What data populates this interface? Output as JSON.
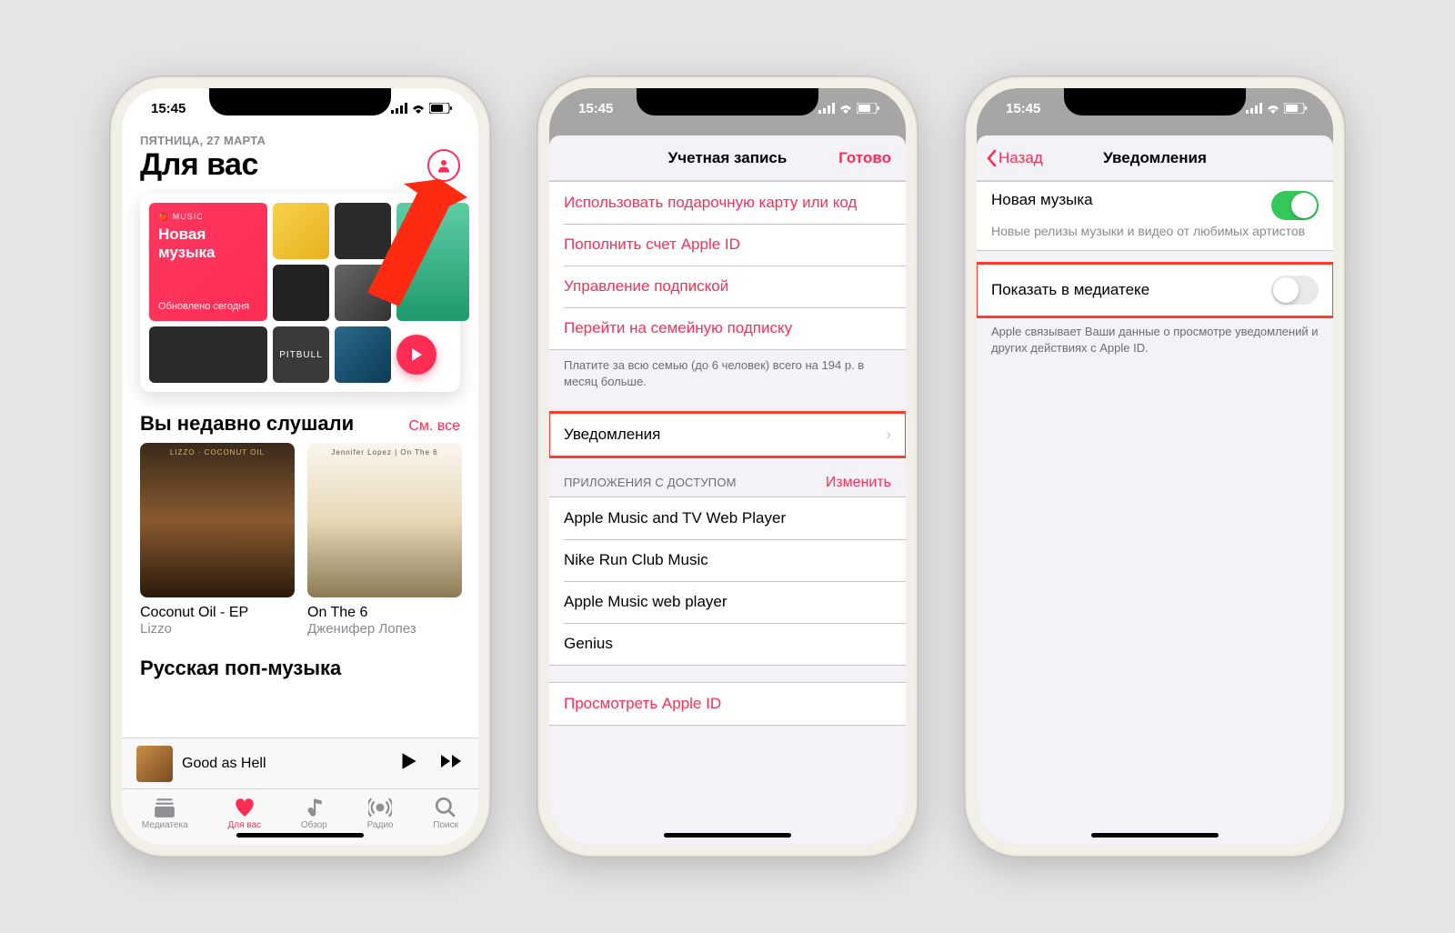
{
  "status": {
    "time": "15:45"
  },
  "phone1": {
    "date": "ПЯТНИЦА, 27 МАРТА",
    "title": "Для вас",
    "new_music_brand": "MUSIC",
    "new_music_title": "Новая\nмузыка",
    "new_music_updated": "Обновлено сегодня",
    "recent_header": "Вы недавно слушали",
    "see_all": "См. все",
    "albums": [
      {
        "cover_text": "LIZZO · COCONUT OIL",
        "title": "Coconut Oil - EP",
        "artist": "Lizzo"
      },
      {
        "cover_text": "Jennifer Lopez | On The 6",
        "title": "On The 6",
        "artist": "Дженифер Лопез"
      }
    ],
    "rus_header": "Русская поп-музыка",
    "now_playing": "Good as Hell",
    "tabs": {
      "library": "Медиатека",
      "for_you": "Для вас",
      "browse": "Обзор",
      "radio": "Радио",
      "search": "Поиск"
    },
    "pitbull_text": "PITBULL"
  },
  "phone2": {
    "nav_title": "Учетная запись",
    "done": "Готово",
    "rows": {
      "gift": "Использовать подарочную карту или код",
      "topup": "Пополнить счет Apple ID",
      "manage_sub": "Управление подпиской",
      "family": "Перейти на семейную подписку",
      "family_note": "Платите за всю семью (до 6 человек) всего на 194 р. в месяц больше.",
      "notifications": "Уведомления",
      "apps_header": "ПРИЛОЖЕНИЯ С ДОСТУПОМ",
      "edit": "Изменить",
      "app1": "Apple Music and TV Web Player",
      "app2": "Nike Run Club Music",
      "app3": "Apple Music web player",
      "app4": "Genius",
      "view_id": "Просмотреть Apple ID"
    }
  },
  "phone3": {
    "back": "Назад",
    "nav_title": "Уведомления",
    "new_music": "Новая музыка",
    "new_music_sub": "Новые релизы музыки и видео от любимых артистов",
    "show_in_lib": "Показать в медиатеке",
    "footer": "Apple связывает Ваши данные о просмотре уведомлений и других действиях с Apple ID."
  }
}
